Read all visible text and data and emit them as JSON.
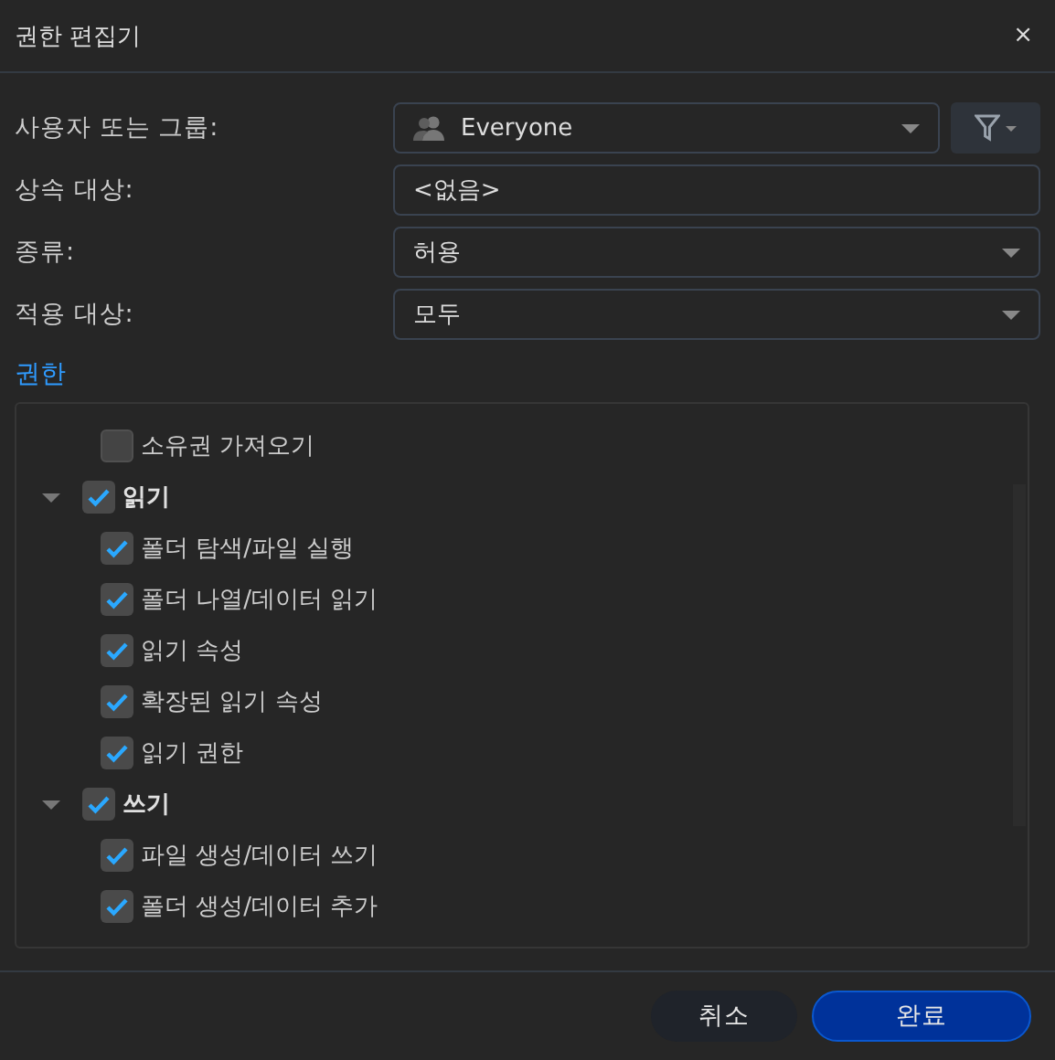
{
  "window": {
    "title": "권한 편집기",
    "close": "×"
  },
  "form": [
    {
      "kind": "group-picker",
      "label": "사용자 또는 그룹:",
      "value": "Everyone"
    },
    {
      "kind": "text",
      "label": "상속 대상:",
      "value": "<없음>"
    },
    {
      "kind": "dropdown",
      "label": "종류:",
      "value": "허용"
    },
    {
      "kind": "dropdown",
      "label": "적용 대상:",
      "value": "모두"
    }
  ],
  "permissions": {
    "heading": "권한",
    "items": [
      {
        "label": "소유권 가져오기",
        "checked": false
      },
      {
        "label": "읽기",
        "checked": true,
        "expanded": true,
        "children": [
          {
            "label": "폴더 탐색/파일 실행",
            "checked": true
          },
          {
            "label": "폴더 나열/데이터 읽기",
            "checked": true
          },
          {
            "label": "읽기 속성",
            "checked": true
          },
          {
            "label": "확장된 읽기 속성",
            "checked": true
          },
          {
            "label": "읽기 권한",
            "checked": true
          }
        ]
      },
      {
        "label": "쓰기",
        "checked": true,
        "expanded": true,
        "children": [
          {
            "label": "파일 생성/데이터 쓰기",
            "checked": true
          },
          {
            "label": "폴더 생성/데이터 추가",
            "checked": true
          }
        ]
      }
    ]
  },
  "buttons": [
    {
      "label": "취소",
      "kind": "secondary"
    },
    {
      "label": "완료",
      "kind": "primary"
    }
  ]
}
